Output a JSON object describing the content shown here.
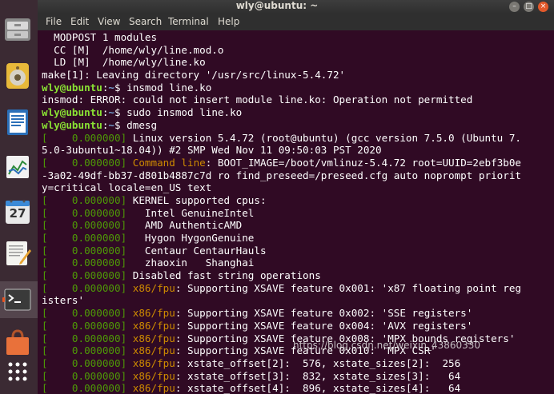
{
  "window": {
    "title": "wly@ubuntu: ~"
  },
  "menu": {
    "items": [
      "File",
      "Edit",
      "View",
      "Search",
      "Terminal",
      "Help"
    ]
  },
  "colors": {
    "dock_bg": "#3b2a33",
    "terminal_bg": "#300a24",
    "prompt_user": "#8ae234",
    "prompt_path": "#729fcf",
    "timestamp": "#4e9a06",
    "kernel_prefix": "#ce8b00"
  },
  "dock": {
    "items": [
      "files-icon",
      "rhythmbox-icon",
      "writer-icon",
      "calc-icon",
      "calendar-icon",
      "text-editor-icon",
      "terminal-icon",
      "software-icon",
      "show-apps-icon"
    ],
    "calendar_day": "27"
  },
  "terminal": {
    "lines": [
      [
        {
          "t": "  MODPOST 1 modules"
        }
      ],
      [
        {
          "t": "  CC [M]  /home/wly/line.mod.o"
        }
      ],
      [
        {
          "t": "  LD [M]  /home/wly/line.ko"
        }
      ],
      [
        {
          "t": "make[1]: Leaving directory '/usr/src/linux-5.4.72'"
        }
      ],
      [
        {
          "t": "wly@ubuntu",
          "c": "gb"
        },
        {
          "t": ":"
        },
        {
          "t": "~",
          "c": "bb"
        },
        {
          "t": "$ insmod line.ko"
        }
      ],
      [
        {
          "t": "insmod: ERROR: could not insert module line.ko: Operation not permitted"
        }
      ],
      [
        {
          "t": "wly@ubuntu",
          "c": "gb"
        },
        {
          "t": ":"
        },
        {
          "t": "~",
          "c": "bb"
        },
        {
          "t": "$ sudo insmod line.ko"
        }
      ],
      [
        {
          "t": "wly@ubuntu",
          "c": "gb"
        },
        {
          "t": ":"
        },
        {
          "t": "~",
          "c": "bb"
        },
        {
          "t": "$ dmesg"
        }
      ],
      [
        {
          "t": "[    0.000000]",
          "c": "g"
        },
        {
          "t": " Linux version 5.4.72 (root@ubuntu) (gcc version 7.5.0 (Ubuntu 7."
        }
      ],
      [
        {
          "t": "5.0-3ubuntu1~18.04)) #2 SMP Wed Nov 11 09:50:03 PST 2020"
        }
      ],
      [
        {
          "t": "[    0.000000]",
          "c": "g"
        },
        {
          "t": " "
        },
        {
          "t": "Command line",
          "c": "o"
        },
        {
          "t": ": BOOT_IMAGE=/boot/vmlinuz-5.4.72 root=UUID=2ebf3b0e"
        }
      ],
      [
        {
          "t": "-3a02-49df-bb37-d801b4887c7d ro find_preseed=/preseed.cfg auto noprompt priorit"
        }
      ],
      [
        {
          "t": "y=critical locale=en_US text"
        }
      ],
      [
        {
          "t": "[    0.000000]",
          "c": "g"
        },
        {
          "t": " KERNEL supported cpus:"
        }
      ],
      [
        {
          "t": "[    0.000000]",
          "c": "g"
        },
        {
          "t": "   Intel GenuineIntel"
        }
      ],
      [
        {
          "t": "[    0.000000]",
          "c": "g"
        },
        {
          "t": "   AMD AuthenticAMD"
        }
      ],
      [
        {
          "t": "[    0.000000]",
          "c": "g"
        },
        {
          "t": "   Hygon HygonGenuine"
        }
      ],
      [
        {
          "t": "[    0.000000]",
          "c": "g"
        },
        {
          "t": "   Centaur CentaurHauls"
        }
      ],
      [
        {
          "t": "[    0.000000]",
          "c": "g"
        },
        {
          "t": "   zhaoxin   Shanghai"
        }
      ],
      [
        {
          "t": "[    0.000000]",
          "c": "g"
        },
        {
          "t": " Disabled fast string operations"
        }
      ],
      [
        {
          "t": "[    0.000000]",
          "c": "g"
        },
        {
          "t": " "
        },
        {
          "t": "x86/fpu",
          "c": "o"
        },
        {
          "t": ": Supporting XSAVE feature 0x001: 'x87 floating point reg"
        }
      ],
      [
        {
          "t": "isters'"
        }
      ],
      [
        {
          "t": "[    0.000000]",
          "c": "g"
        },
        {
          "t": " "
        },
        {
          "t": "x86/fpu",
          "c": "o"
        },
        {
          "t": ": Supporting XSAVE feature 0x002: 'SSE registers'"
        }
      ],
      [
        {
          "t": "[    0.000000]",
          "c": "g"
        },
        {
          "t": " "
        },
        {
          "t": "x86/fpu",
          "c": "o"
        },
        {
          "t": ": Supporting XSAVE feature 0x004: 'AVX registers'"
        }
      ],
      [
        {
          "t": "[    0.000000]",
          "c": "g"
        },
        {
          "t": " "
        },
        {
          "t": "x86/fpu",
          "c": "o"
        },
        {
          "t": ": Supporting XSAVE feature 0x008: 'MPX bounds registers'"
        }
      ],
      [
        {
          "t": "[    0.000000]",
          "c": "g"
        },
        {
          "t": " "
        },
        {
          "t": "x86/fpu",
          "c": "o"
        },
        {
          "t": ": Supporting XSAVE feature 0x010: 'MPX CSR'"
        }
      ],
      [
        {
          "t": "[    0.000000]",
          "c": "g"
        },
        {
          "t": " "
        },
        {
          "t": "x86/fpu",
          "c": "o"
        },
        {
          "t": ": xstate_offset[2]:  576, xstate_sizes[2]:  256"
        }
      ],
      [
        {
          "t": "[    0.000000]",
          "c": "g"
        },
        {
          "t": " "
        },
        {
          "t": "x86/fpu",
          "c": "o"
        },
        {
          "t": ": xstate_offset[3]:  832, xstate_sizes[3]:   64"
        }
      ],
      [
        {
          "t": "[    0.000000]",
          "c": "g"
        },
        {
          "t": " "
        },
        {
          "t": "x86/fpu",
          "c": "o"
        },
        {
          "t": ": xstate_offset[4]:  896, xstate_sizes[4]:   64"
        }
      ]
    ]
  },
  "watermark": "https://blog.csdn.net/weixin_43860330"
}
